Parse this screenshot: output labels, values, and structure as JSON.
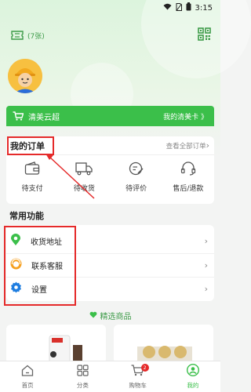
{
  "status_bar": {
    "time": "3:15"
  },
  "header": {
    "coupon_count": "(7张)"
  },
  "member_card": {
    "title": "清美云超",
    "link": "我的清美卡 》"
  },
  "orders": {
    "title": "我的订单",
    "view_all": "查看全部订单",
    "items": [
      {
        "label": "待支付",
        "icon": "wallet-icon"
      },
      {
        "label": "待收货",
        "icon": "truck-icon"
      },
      {
        "label": "待评价",
        "icon": "review-icon"
      },
      {
        "label": "售后/退款",
        "icon": "headset-icon"
      }
    ]
  },
  "common": {
    "title": "常用功能",
    "items": [
      {
        "label": "收货地址",
        "icon": "location-pin-icon"
      },
      {
        "label": "联系客服",
        "icon": "customer-service-icon"
      },
      {
        "label": "设置",
        "icon": "gear-icon"
      }
    ]
  },
  "featured": {
    "label": "精选商品"
  },
  "bottom_nav": {
    "items": [
      {
        "label": "首页",
        "icon": "home-icon"
      },
      {
        "label": "分类",
        "icon": "category-icon"
      },
      {
        "label": "购物车",
        "icon": "cart-icon",
        "badge": "2"
      },
      {
        "label": "我的",
        "icon": "profile-icon",
        "active": true
      }
    ]
  },
  "colors": {
    "accent": "#3bbf4a",
    "annotation": "#e52a2a"
  }
}
